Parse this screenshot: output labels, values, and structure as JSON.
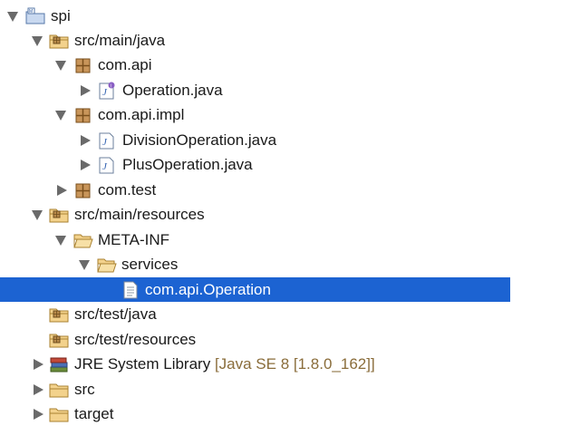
{
  "tree": [
    {
      "label": "spi",
      "icon": "project-icon",
      "expanded": true
    },
    {
      "label": "src/main/java",
      "icon": "source-folder-icon",
      "expanded": true
    },
    {
      "label": "com.api",
      "icon": "package-icon",
      "expanded": true
    },
    {
      "label": "Operation.java",
      "icon": "java-interface-file-icon",
      "expanded": false
    },
    {
      "label": "com.api.impl",
      "icon": "package-icon",
      "expanded": true
    },
    {
      "label": "DivisionOperation.java",
      "icon": "java-file-icon",
      "expanded": false
    },
    {
      "label": "PlusOperation.java",
      "icon": "java-file-icon",
      "expanded": false
    },
    {
      "label": "com.test",
      "icon": "package-icon",
      "expanded": false
    },
    {
      "label": "src/main/resources",
      "icon": "source-folder-icon",
      "expanded": true
    },
    {
      "label": "META-INF",
      "icon": "folder-open-icon",
      "expanded": true
    },
    {
      "label": "services",
      "icon": "folder-open-icon",
      "expanded": true
    },
    {
      "label": "com.api.Operation",
      "icon": "text-file-icon",
      "selected": true
    },
    {
      "label": "src/test/java",
      "icon": "source-folder-icon"
    },
    {
      "label": "src/test/resources",
      "icon": "source-folder-icon"
    },
    {
      "label": "JRE System Library",
      "decoration": "[Java SE 8 [1.8.0_162]]",
      "icon": "library-icon",
      "expanded": false
    },
    {
      "label": "src",
      "icon": "folder-icon",
      "expanded": false
    },
    {
      "label": "target",
      "icon": "folder-icon",
      "expanded": false
    }
  ],
  "colors": {
    "selection": "#1c63d2",
    "decoration": "#8a6d3b",
    "twisty": "#6a6a6a"
  }
}
